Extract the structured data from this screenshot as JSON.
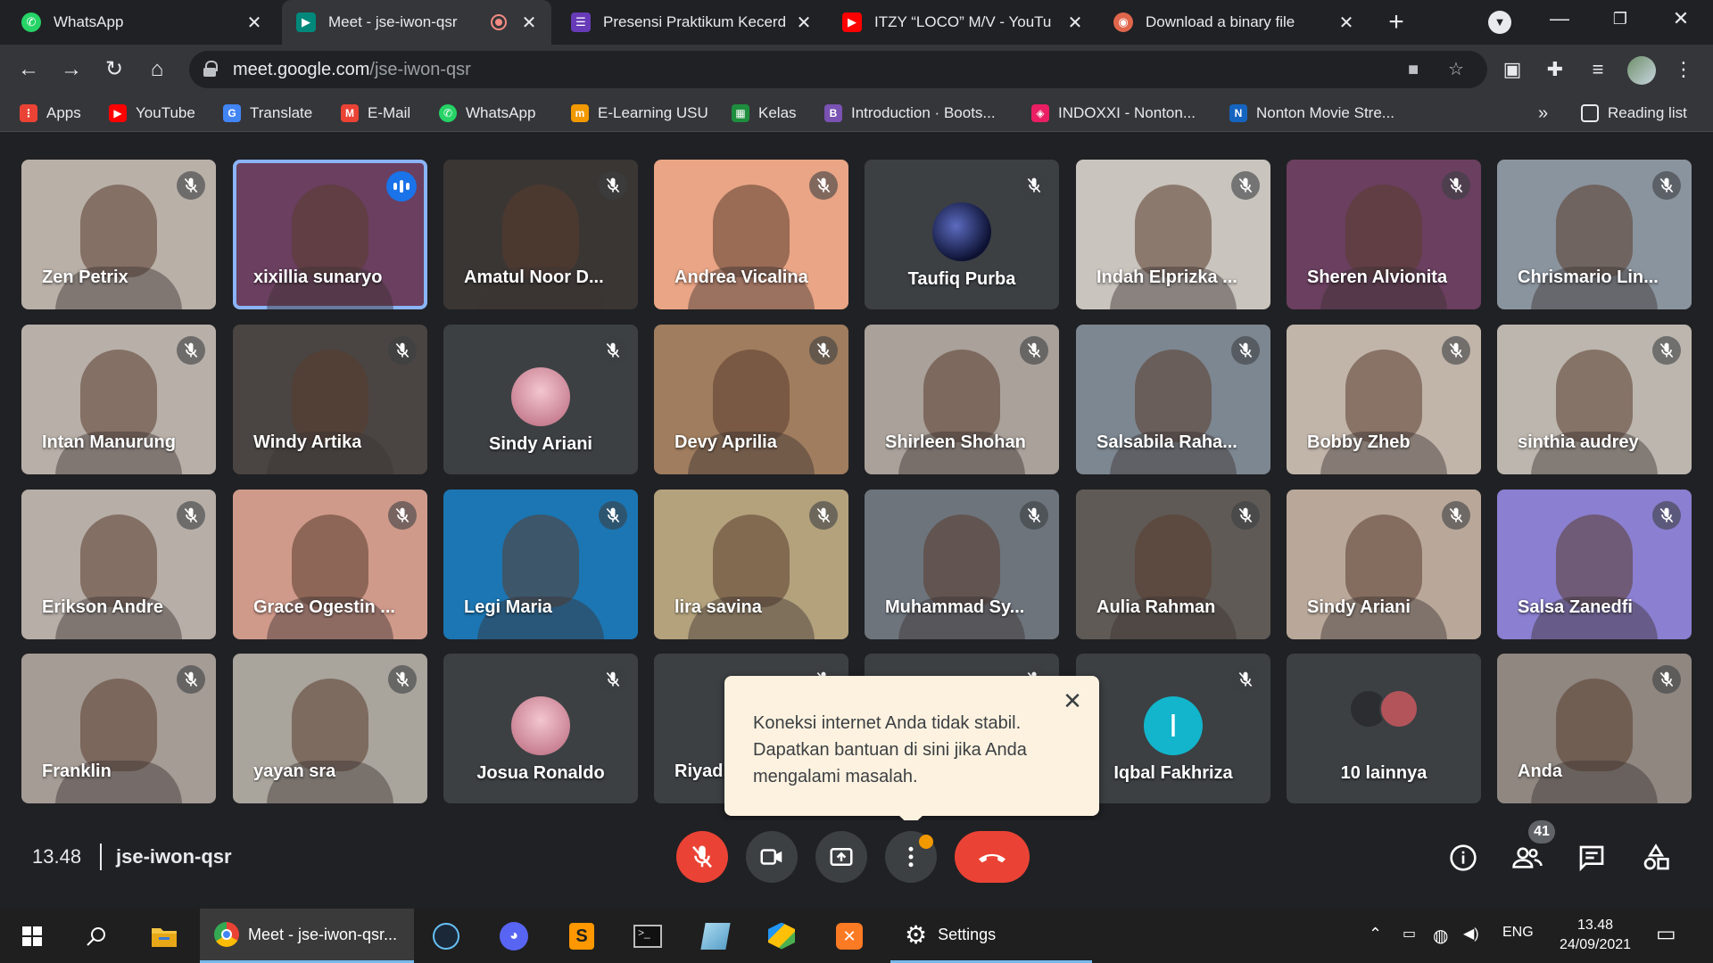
{
  "browser": {
    "tabs": [
      {
        "label": "WhatsApp",
        "icon": "whatsapp-icon",
        "color": "#25d366"
      },
      {
        "label": "Meet - jse-iwon-qsr",
        "icon": "google-meet-icon",
        "color": "#00897b",
        "active": true,
        "recording": true
      },
      {
        "label": "Presensi Praktikum Kecerd",
        "icon": "google-forms-icon",
        "color": "#673ab7"
      },
      {
        "label": "ITZY “LOCO” M/V - YouTu",
        "icon": "youtube-icon",
        "color": "#ff0000"
      },
      {
        "label": "Download a binary file",
        "icon": "download-site-icon",
        "color": "#e0664b"
      }
    ],
    "url_host": "meet.google.com",
    "url_path": "/jse-iwon-qsr",
    "bookmarks": [
      {
        "label": "Apps",
        "icon": "apps-grid-icon",
        "color": "#ea4335"
      },
      {
        "label": "YouTube",
        "icon": "youtube-icon",
        "color": "#ff0000"
      },
      {
        "label": "Translate",
        "icon": "translate-icon",
        "color": "#4285f4"
      },
      {
        "label": "E-Mail",
        "icon": "gmail-icon",
        "color": "#ea4335"
      },
      {
        "label": "WhatsApp",
        "icon": "whatsapp-icon",
        "color": "#25d366"
      },
      {
        "label": "E-Learning USU",
        "icon": "elearning-icon",
        "color": "#f29900"
      },
      {
        "label": "Kelas",
        "icon": "google-classroom-icon",
        "color": "#1e8e3e"
      },
      {
        "label": "Introduction · Boots...",
        "icon": "bootstrap-icon",
        "color": "#7952b3"
      },
      {
        "label": "INDOXXI - Nonton...",
        "icon": "indoxxi-icon",
        "color": "#e91e63"
      },
      {
        "label": "Nonton Movie Stre...",
        "icon": "movie-site-icon",
        "color": "#1565c0"
      }
    ],
    "reading_list": "Reading list"
  },
  "meet": {
    "participants": [
      {
        "name": "Zen Petrix",
        "bg": "#b9b0a8",
        "muted": true
      },
      {
        "name": "xixillia sunaryo",
        "bg": "#6a3f5f",
        "speaking": true
      },
      {
        "name": "Amatul Noor D...",
        "bg": "#3a3634",
        "muted": true
      },
      {
        "name": "Andrea Vicalina",
        "bg": "#e9a585",
        "muted": true
      },
      {
        "name": "Taufiq Purba",
        "bg": "#3c4043",
        "muted": true,
        "avatar": "space-avatar"
      },
      {
        "name": "Indah Elprizka ...",
        "bg": "#c9c4bd",
        "muted": true
      },
      {
        "name": "Sheren Alvionita",
        "bg": "#6a3f5f",
        "muted": true
      },
      {
        "name": "Chrismario Lin...",
        "bg": "#8a949e",
        "muted": true
      },
      {
        "name": "Intan Manurung",
        "bg": "#b8b0a8",
        "muted": true
      },
      {
        "name": "Windy Artika",
        "bg": "#4a4542",
        "muted": true
      },
      {
        "name": "Sindy Ariani",
        "bg": "#3c4043",
        "muted": true,
        "avatar": "photo-avatar"
      },
      {
        "name": "Devy Aprilia",
        "bg": "#a07d5e",
        "muted": true
      },
      {
        "name": "Shirleen Shohan",
        "bg": "#a9a19a",
        "muted": true
      },
      {
        "name": "Salsabila Raha...",
        "bg": "#7d8791",
        "muted": true
      },
      {
        "name": "Bobby Zheb",
        "bg": "#c1b5aa",
        "muted": true
      },
      {
        "name": "sinthia audrey",
        "bg": "#bcb6ae",
        "muted": true
      },
      {
        "name": "Erikson Andre",
        "bg": "#b6aea7",
        "muted": true
      },
      {
        "name": "Grace Ogestin ...",
        "bg": "#cf9a8a",
        "muted": true
      },
      {
        "name": "Legi Maria",
        "bg": "#1b76b3",
        "muted": true
      },
      {
        "name": "lira savina",
        "bg": "#b4a27d",
        "muted": true
      },
      {
        "name": "Muhammad Sy...",
        "bg": "#6d747c",
        "muted": true
      },
      {
        "name": "Aulia Rahman",
        "bg": "#5f5a55",
        "muted": true
      },
      {
        "name": "Sindy Ariani",
        "bg": "#b9a899",
        "muted": true
      },
      {
        "name": "Salsa Zanedfi",
        "bg": "#8a7fd0",
        "muted": true
      },
      {
        "name": "Franklin",
        "bg": "#a59c95",
        "muted": true
      },
      {
        "name": "yayan sra",
        "bg": "#a9a49c",
        "muted": true
      },
      {
        "name": "Josua Ronaldo",
        "bg": "#3c4043",
        "muted": true,
        "avatar": "photo-avatar"
      },
      {
        "name": "Riyadh",
        "bg": "#3c4043",
        "muted": true
      },
      {
        "name": "",
        "bg": "#3c4043",
        "muted": true
      },
      {
        "name": "Iqbal Fakhriza",
        "bg": "#3c4043",
        "muted": true,
        "avatar": "letter-avatar",
        "letter": "I"
      },
      {
        "name": "10 lainnya",
        "bg": "#3c4043",
        "overflow": true
      },
      {
        "name": "Anda",
        "bg": "#8f8780",
        "muted": true
      }
    ],
    "tooltip": {
      "line1": "Koneksi internet Anda tidak stabil.",
      "line2": "Dapatkan bantuan di sini jika Anda",
      "line3": "mengalami masalah."
    },
    "time": "13.48",
    "meeting_code": "jse-iwon-qsr",
    "participant_count": "41",
    "colors": {
      "end_call": "#ea4335",
      "mic_off": "#ea4335",
      "notify": "#f29900",
      "speaking": "#8ab4f8"
    }
  },
  "taskbar": {
    "active_app": "Meet - jse-iwon-qsr...",
    "settings_app": "Settings",
    "lang": "ENG",
    "time": "13.48",
    "date": "24/09/2021"
  }
}
